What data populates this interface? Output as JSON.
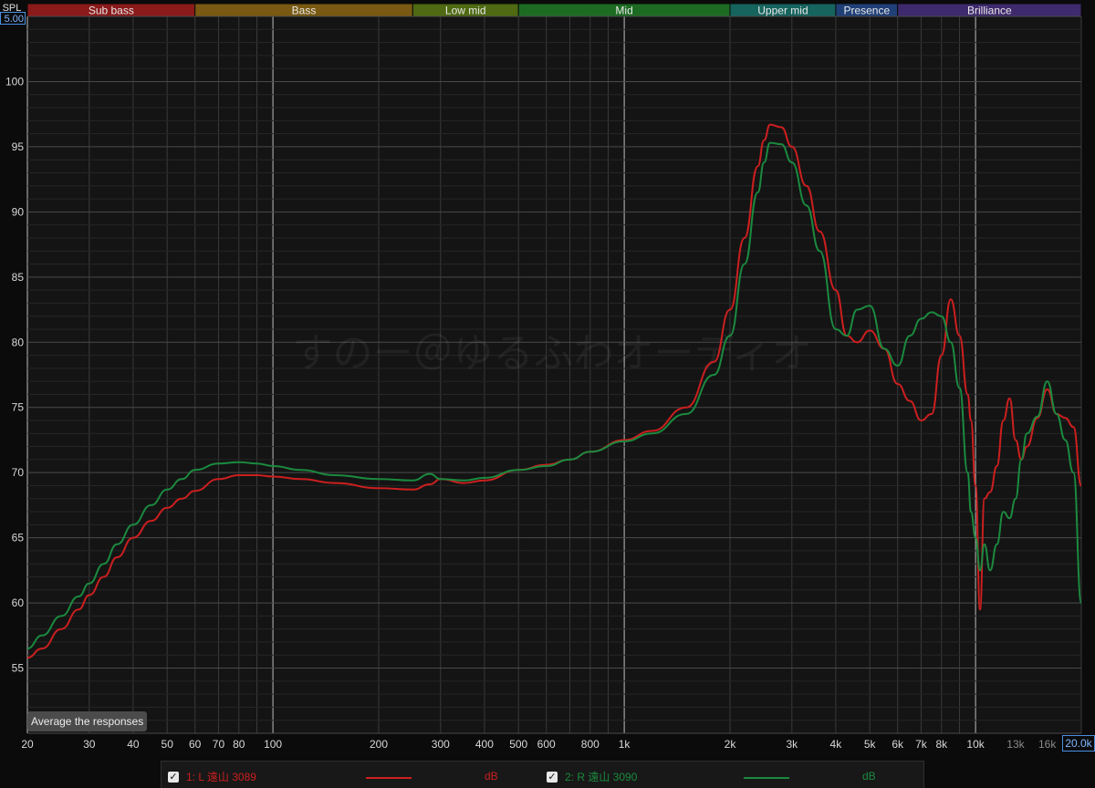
{
  "header": {
    "spl_label": "SPL",
    "ymax_value": "5.00",
    "xmax_value": "20.0k"
  },
  "bands": [
    {
      "label": "Sub bass",
      "from": 20,
      "to": 60,
      "color": "#8b1a1a"
    },
    {
      "label": "Bass",
      "from": 60,
      "to": 250,
      "color": "#7a5a12"
    },
    {
      "label": "Low mid",
      "from": 250,
      "to": 500,
      "color": "#4f6a12"
    },
    {
      "label": "Mid",
      "from": 500,
      "to": 2000,
      "color": "#1d6b23"
    },
    {
      "label": "Upper mid",
      "from": 2000,
      "to": 4000,
      "color": "#16645e"
    },
    {
      "label": "Presence",
      "from": 4000,
      "to": 6000,
      "color": "#1f3f77"
    },
    {
      "label": "Brilliance",
      "from": 6000,
      "to": 20000,
      "color": "#3e2a6d"
    }
  ],
  "button": {
    "average_label": "Average the responses"
  },
  "watermark": "すのー＠ゆるふわオーディオ",
  "legend": [
    {
      "checkbox": "✓",
      "name": "1: L 遠山 3089",
      "unit": "dB",
      "color": "#cc1f1f"
    },
    {
      "checkbox": "✓",
      "name": "2: R 遠山 3090",
      "unit": "dB",
      "color": "#1b8a3f"
    }
  ],
  "chart_data": {
    "type": "line",
    "xlabel": "",
    "ylabel": "SPL",
    "x_scale": "log",
    "xlim": [
      20,
      20000
    ],
    "ylim": [
      50,
      105
    ],
    "grid": true,
    "y_ticks": [
      55,
      60,
      65,
      70,
      75,
      80,
      85,
      90,
      95,
      100
    ],
    "x_ticks": [
      {
        "value": 20,
        "label": "20"
      },
      {
        "value": 30,
        "label": "30"
      },
      {
        "value": 40,
        "label": "40"
      },
      {
        "value": 50,
        "label": "50"
      },
      {
        "value": 60,
        "label": "60"
      },
      {
        "value": 70,
        "label": "70"
      },
      {
        "value": 80,
        "label": "80"
      },
      {
        "value": 100,
        "label": "100"
      },
      {
        "value": 200,
        "label": "200"
      },
      {
        "value": 300,
        "label": "300"
      },
      {
        "value": 400,
        "label": "400"
      },
      {
        "value": 500,
        "label": "500"
      },
      {
        "value": 600,
        "label": "600"
      },
      {
        "value": 800,
        "label": "800"
      },
      {
        "value": 1000,
        "label": "1k"
      },
      {
        "value": 2000,
        "label": "2k"
      },
      {
        "value": 3000,
        "label": "3k"
      },
      {
        "value": 4000,
        "label": "4k"
      },
      {
        "value": 5000,
        "label": "5k"
      },
      {
        "value": 6000,
        "label": "6k"
      },
      {
        "value": 7000,
        "label": "7k"
      },
      {
        "value": 8000,
        "label": "8k"
      },
      {
        "value": 10000,
        "label": "10k"
      },
      {
        "value": 13000,
        "label": "13k",
        "dim": true
      },
      {
        "value": 16000,
        "label": "16k",
        "dim": true
      }
    ],
    "series": [
      {
        "name": "1: L 遠山 3089",
        "color": "#cc1f1f",
        "x": [
          20,
          22,
          25,
          28,
          30,
          33,
          36,
          40,
          45,
          50,
          55,
          60,
          70,
          80,
          90,
          100,
          120,
          150,
          200,
          250,
          280,
          300,
          350,
          400,
          500,
          600,
          700,
          800,
          1000,
          1200,
          1500,
          1800,
          2000,
          2200,
          2400,
          2500,
          2600,
          2800,
          3000,
          3300,
          3600,
          4000,
          4300,
          4600,
          5000,
          5500,
          6000,
          6500,
          7000,
          7500,
          8000,
          8500,
          9000,
          9500,
          9700,
          10000,
          10300,
          10600,
          11000,
          11500,
          12000,
          12500,
          13000,
          13500,
          14000,
          15000,
          16000,
          17000,
          18000,
          19000,
          20000
        ],
        "y": [
          55.8,
          56.5,
          58.0,
          59.5,
          60.6,
          62.0,
          63.5,
          65.0,
          66.3,
          67.3,
          68.0,
          68.6,
          69.5,
          69.8,
          69.8,
          69.7,
          69.5,
          69.2,
          68.8,
          68.7,
          69.1,
          69.5,
          69.2,
          69.4,
          70.2,
          70.6,
          71.0,
          71.6,
          72.5,
          73.2,
          75.0,
          78.5,
          82.5,
          88.0,
          93.5,
          95.5,
          96.7,
          96.5,
          95.0,
          92.0,
          88.5,
          84.0,
          80.5,
          80.0,
          80.9,
          79.5,
          76.8,
          75.5,
          74.0,
          74.5,
          79.0,
          83.3,
          80.5,
          76.0,
          74.0,
          69.0,
          59.5,
          68.0,
          68.5,
          70.5,
          74.0,
          75.7,
          72.5,
          71.0,
          72.0,
          74.2,
          76.4,
          74.5,
          74.2,
          73.5,
          69.0
        ]
      },
      {
        "name": "2: R 遠山 3090",
        "color": "#1b8a3f",
        "x": [
          20,
          22,
          25,
          28,
          30,
          33,
          36,
          40,
          45,
          50,
          55,
          60,
          70,
          80,
          90,
          100,
          120,
          150,
          200,
          250,
          280,
          300,
          350,
          400,
          500,
          600,
          700,
          800,
          1000,
          1200,
          1500,
          1800,
          2000,
          2200,
          2400,
          2500,
          2600,
          2800,
          3000,
          3300,
          3600,
          4000,
          4300,
          4600,
          5000,
          5500,
          6000,
          6500,
          7000,
          7500,
          8000,
          8500,
          9000,
          9500,
          9700,
          10000,
          10300,
          10600,
          11000,
          11500,
          12000,
          12500,
          13000,
          13500,
          14000,
          15000,
          16000,
          17000,
          18000,
          19000,
          20000
        ],
        "y": [
          56.5,
          57.5,
          59.0,
          60.5,
          61.5,
          63.0,
          64.5,
          66.0,
          67.5,
          68.7,
          69.5,
          70.2,
          70.7,
          70.8,
          70.7,
          70.5,
          70.2,
          69.8,
          69.5,
          69.4,
          69.9,
          69.5,
          69.4,
          69.6,
          70.2,
          70.5,
          71.0,
          71.6,
          72.4,
          73.0,
          74.5,
          77.5,
          80.5,
          86.0,
          91.5,
          93.8,
          95.3,
          95.2,
          93.8,
          90.5,
          87.0,
          81.0,
          80.5,
          82.5,
          82.8,
          79.5,
          78.2,
          80.5,
          81.8,
          82.3,
          82.0,
          80.0,
          76.5,
          70.0,
          67.0,
          65.0,
          62.5,
          64.5,
          62.5,
          64.5,
          67.0,
          66.5,
          68.0,
          71.0,
          73.0,
          74.3,
          77.0,
          74.5,
          72.5,
          70.0,
          60.0
        ]
      }
    ]
  }
}
